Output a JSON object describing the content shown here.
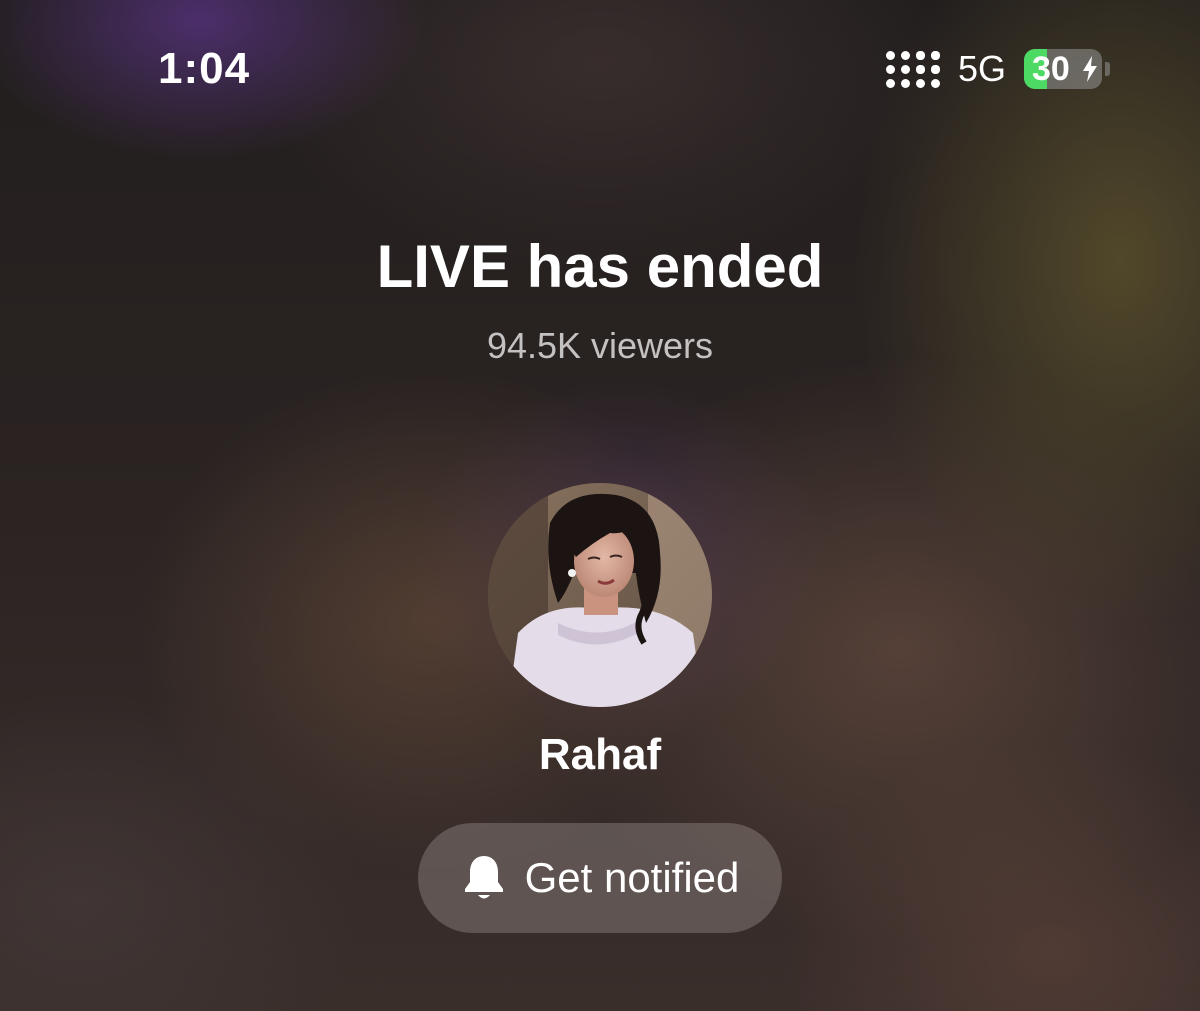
{
  "status_bar": {
    "time": "1:04",
    "network": "5G",
    "battery_percent": "30",
    "battery_level": 0.3,
    "battery_fill_color": "#4cd964",
    "signal_icon": "signal-bars-icon",
    "charging_icon": "bolt-icon"
  },
  "live": {
    "title": "LIVE has ended",
    "viewers": "94.5K viewers"
  },
  "host": {
    "name": "Rahaf",
    "avatar": "profile-photo"
  },
  "actions": {
    "notify_label": "Get notified",
    "notify_icon": "bell-icon"
  }
}
